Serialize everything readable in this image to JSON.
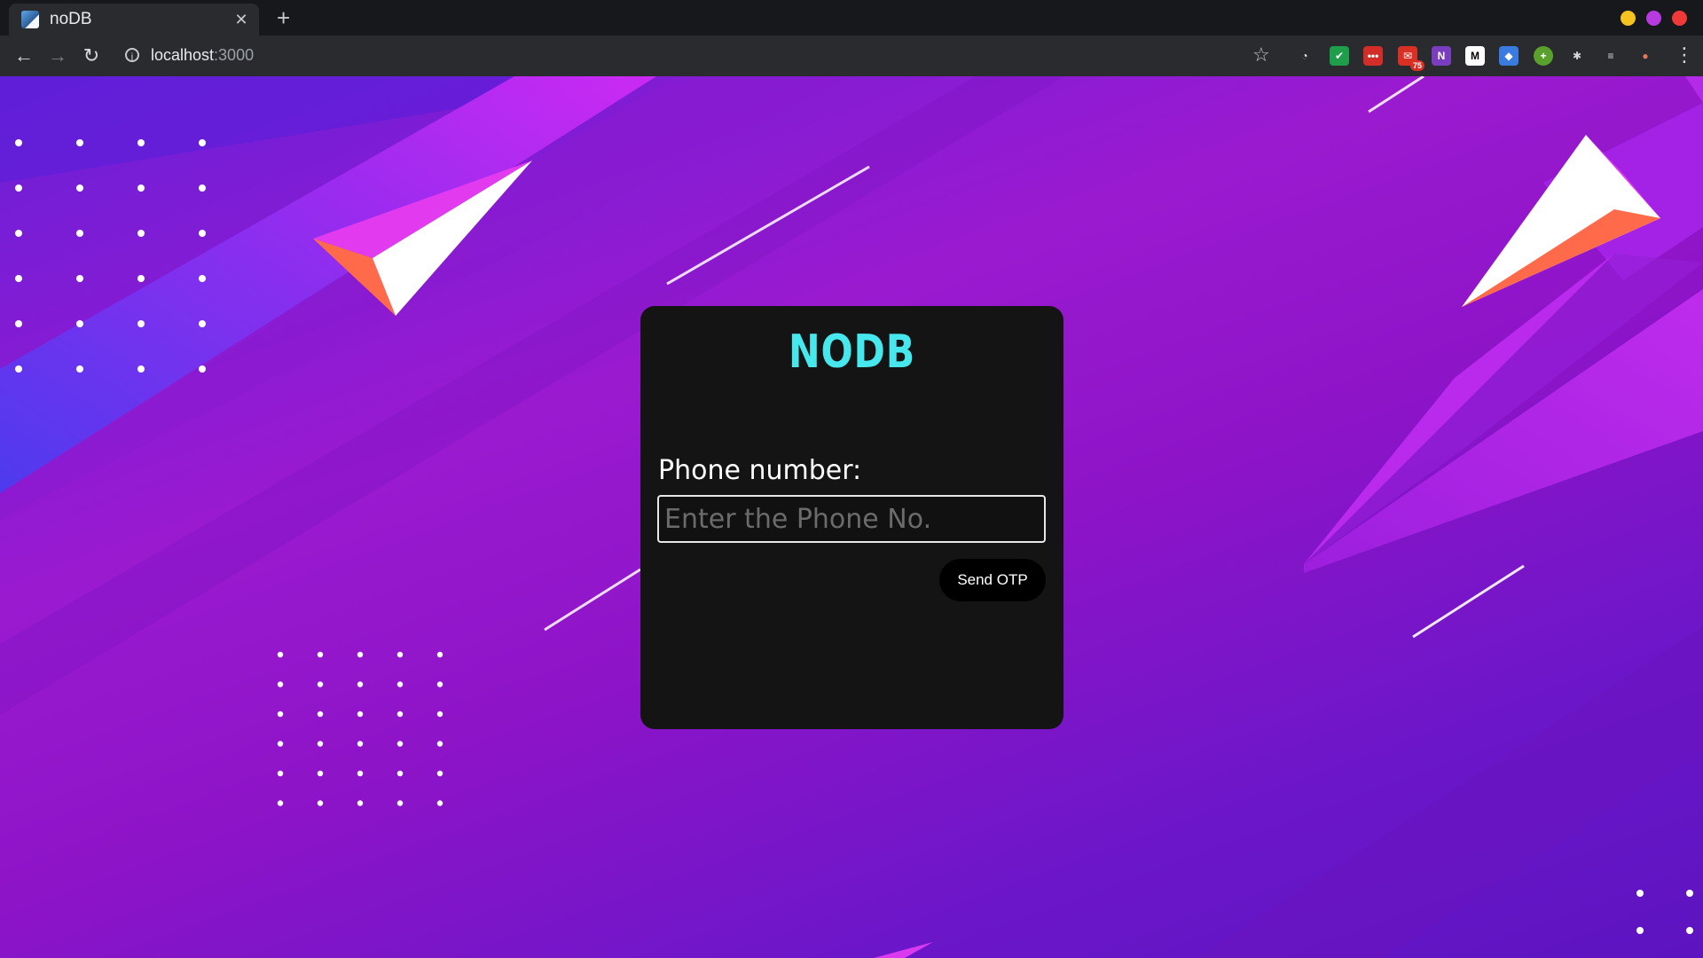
{
  "browser": {
    "tab_title": "noDB",
    "tab_close": "✕",
    "new_tab": "+",
    "url_host": "localhost",
    "url_port": ":3000",
    "back": "←",
    "forward": "→",
    "reload": "↻",
    "info": "i",
    "star": "☆",
    "menu": "⋮",
    "window_controls": [
      {
        "name": "minimize",
        "color": "#f7c31f"
      },
      {
        "name": "maximize",
        "color": "#b73ae0"
      },
      {
        "name": "close",
        "color": "#f03a3a"
      }
    ],
    "extensions": [
      {
        "name": "incognito-extension-icon",
        "glyph": "◔",
        "color": "#2a2b2f"
      },
      {
        "name": "shield-extension-icon",
        "glyph": "✔",
        "color": "#1e9e4a"
      },
      {
        "name": "lastpass-extension-icon",
        "glyph": "•••",
        "color": "#d32d27"
      },
      {
        "name": "mail-extension-icon",
        "glyph": "✉",
        "color": "#d93025",
        "badge": "75"
      },
      {
        "name": "onenote-extension-icon",
        "glyph": "N",
        "color": "#7b3dbf"
      },
      {
        "name": "medium-extension-icon",
        "glyph": "M",
        "color": "#ffffff"
      },
      {
        "name": "vpn-extension-icon",
        "glyph": "◆",
        "color": "#3a7be0"
      },
      {
        "name": "plus-extension-icon",
        "glyph": "+",
        "color": "#5aa02c"
      },
      {
        "name": "puzzle-extension-icon",
        "glyph": "✱",
        "color": "#2a2b2f"
      },
      {
        "name": "media-control-icon",
        "glyph": "≡",
        "color": "#2a2b2f"
      },
      {
        "name": "profile-avatar",
        "glyph": "●",
        "color": "#8c2b2b"
      }
    ]
  },
  "card": {
    "brand": "NODB",
    "phone_label": "Phone number:",
    "phone_placeholder": "Enter the Phone No.",
    "phone_value": "",
    "send_button": "Send OTP"
  },
  "colors": {
    "brand": "#46e8ee",
    "card_bg": "#141414"
  }
}
